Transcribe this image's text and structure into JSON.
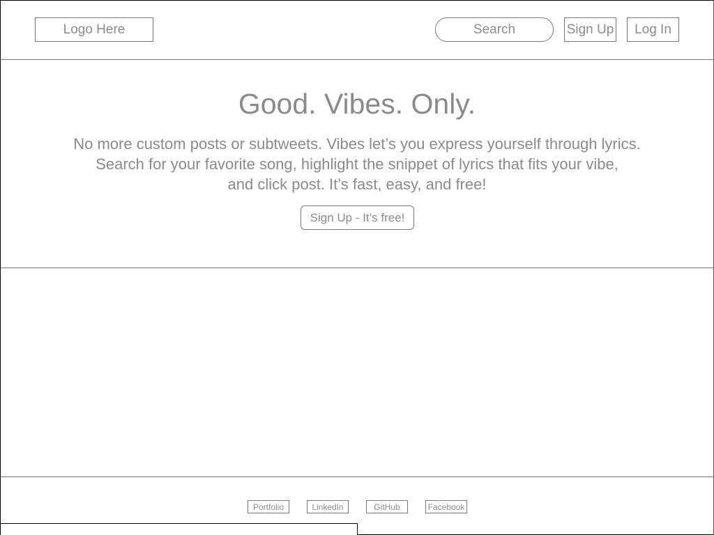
{
  "header": {
    "logo_text": "Logo Here",
    "search_label": "Search",
    "signup_label": "Sign Up",
    "login_label": "Log In"
  },
  "hero": {
    "title": "Good. Vibes. Only.",
    "lines": [
      "No more custom posts or subtweets. Vibes let’s you express yourself through lyrics.",
      "Search for your favorite song, highlight the snippet of lyrics that fits your vibe,",
      "and click post. It’s fast, easy, and free!"
    ],
    "cta_label": "Sign Up - It’s free!"
  },
  "footer": {
    "links": [
      "Portfolio",
      "LinkedIn",
      "GitHub",
      "Facebook"
    ]
  },
  "colors": {
    "text": "#8a8a8a",
    "border": "#777777",
    "background": "#ffffff"
  }
}
